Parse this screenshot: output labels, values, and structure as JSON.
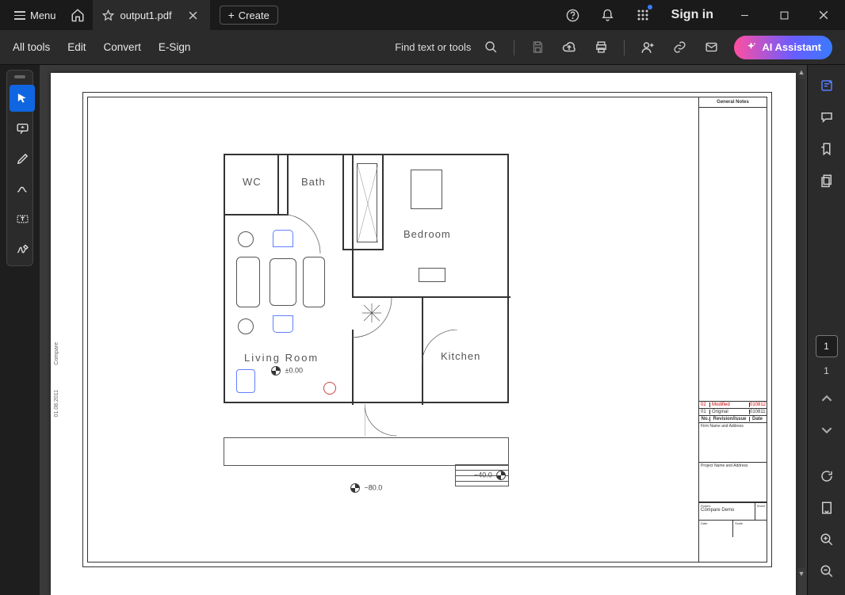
{
  "titlebar": {
    "menu_label": "Menu",
    "tab_title": "output1.pdf",
    "create_label": "Create",
    "sign_in": "Sign in"
  },
  "toolbar": {
    "all_tools": "All tools",
    "edit": "Edit",
    "convert": "Convert",
    "esign": "E-Sign",
    "find": "Find text or tools",
    "ai_assistant": "AI Assistant"
  },
  "right_panel": {
    "page_current": "1",
    "page_total": "1"
  },
  "document": {
    "title_block": {
      "general_notes": "General Notes",
      "rev2_no": "02",
      "rev2_text": "Modified",
      "rev2_date": "010812",
      "rev1_no": "01",
      "rev1_text": "Original",
      "rev1_date": "010811",
      "header_no": "No.",
      "header_rev": "Revision/Issue",
      "header_date": "Date",
      "firm_label": "Firm Name and Address",
      "project_label": "Project Name and Address",
      "project_value_label": "Project",
      "project_value": "Compare Demo",
      "sheet_label": "Sheet",
      "date_label": "Date",
      "scale_label": "Scale"
    },
    "plan": {
      "wc": "WC",
      "bath": "Bath",
      "bedroom": "Bedroom",
      "kitchen": "Kitchen",
      "living": "Living Room",
      "level0": "±0.00",
      "level80": "−80.0",
      "level40": "−40.0"
    },
    "side_note": "01.08.2011",
    "side_note2": "Compare"
  }
}
